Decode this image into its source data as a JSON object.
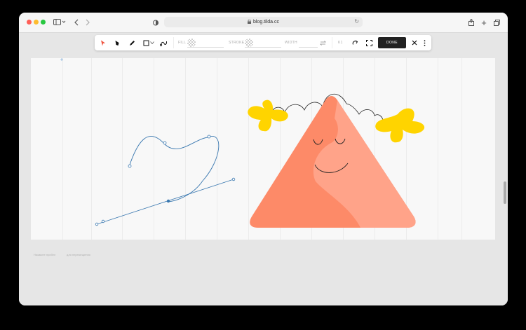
{
  "browser": {
    "url": "blog.tilda.cc",
    "icons": [
      "sidebar-icon",
      "back-icon",
      "forward-icon",
      "shield-icon",
      "lock-icon",
      "reload-icon",
      "share-icon",
      "new-tab-icon",
      "tabs-icon"
    ]
  },
  "toolbar": {
    "fill_label": "FILL",
    "stroke_label": "STROKE",
    "width_label": "WIDTH",
    "shortcut_label": "K1",
    "done_label": "DONE",
    "tools": [
      "select-arrow-icon",
      "direct-select-icon",
      "pencil-icon",
      "rectangle-icon",
      "chevron-down-icon",
      "path-icon",
      "swap-icon",
      "redo-icon",
      "fullscreen-icon",
      "close-icon",
      "more-icon"
    ]
  },
  "canvas": {
    "colors": {
      "triangle_base": "#fd8a68",
      "triangle_light": "#ffa389",
      "flower": "#ffd400",
      "path_blue": "#3a78b0",
      "accent_red": "#f0523e"
    }
  },
  "footer": {
    "left_text": "Нажмите пробел",
    "right_text": "для перемещения"
  }
}
